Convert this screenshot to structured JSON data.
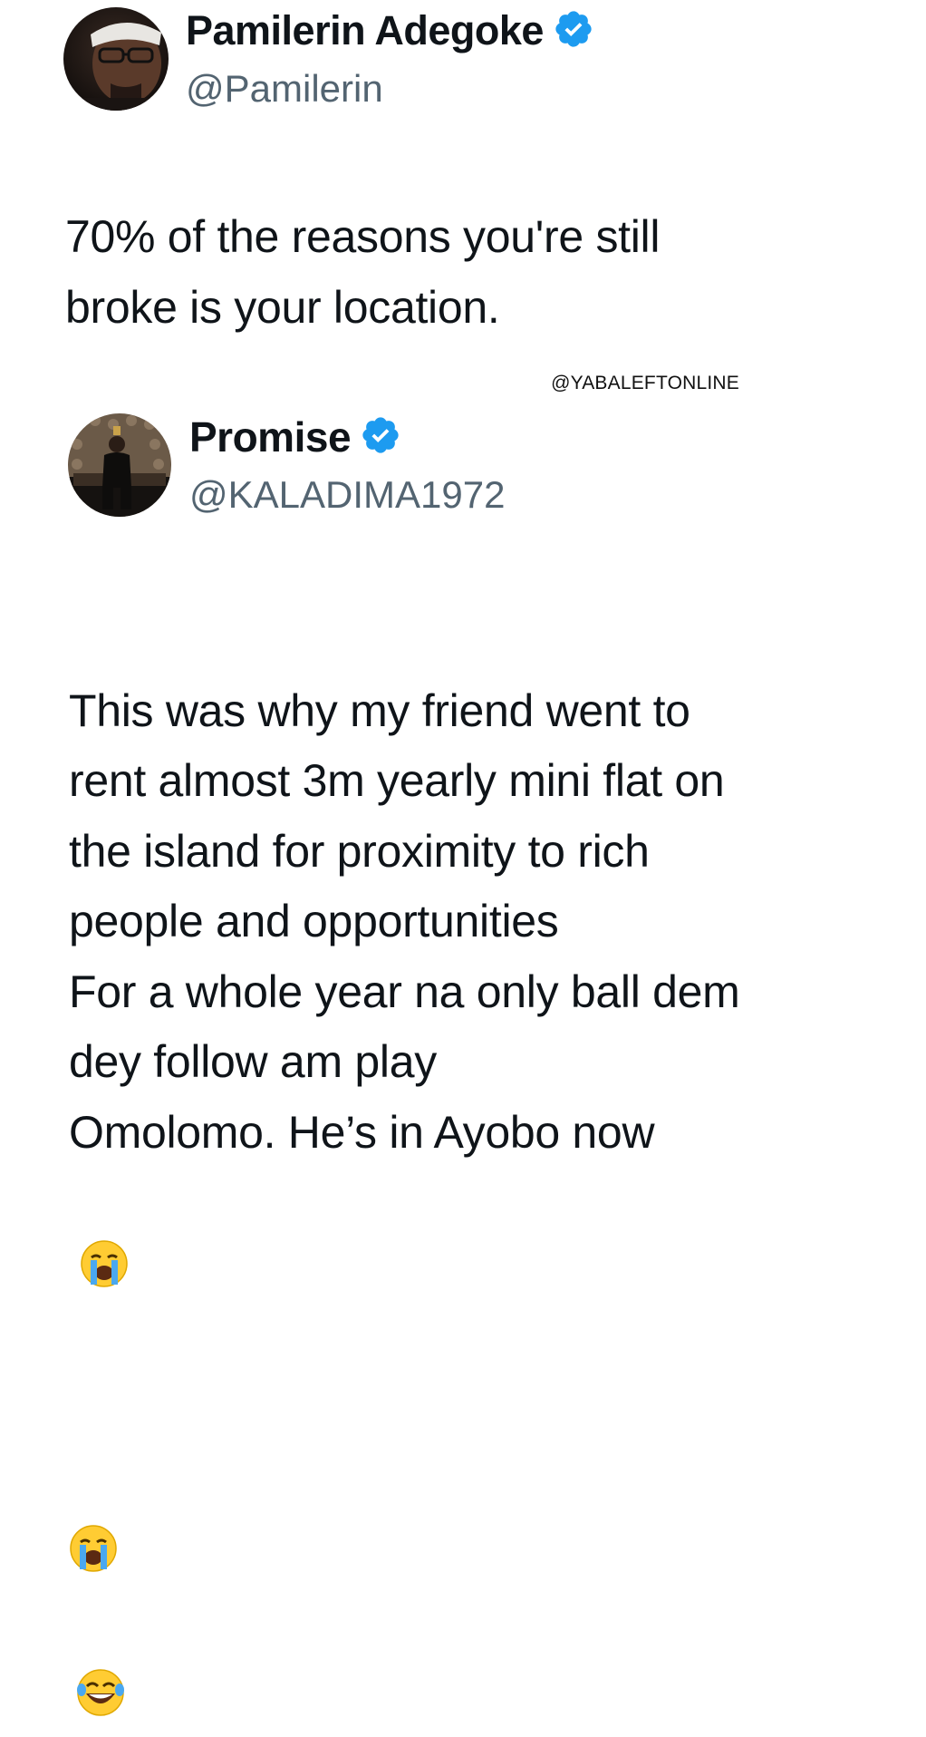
{
  "tweet1": {
    "display_name": "Pamilerin Adegoke",
    "handle": "@Pamilerin",
    "verified": true,
    "avatar_icon": "avatar-photo",
    "text": "70% of the reasons you're still\nbroke is your location."
  },
  "watermark": "@YABALEFTONLINE",
  "tweet2": {
    "display_name": "Promise",
    "handle": "@KALADIMA1972",
    "verified": true,
    "avatar_icon": "avatar-photo",
    "text": "This was why my friend went to\nrent almost 3m yearly mini flat on\nthe island for proximity to rich\npeople and opportunities\nFor a whole year na only ball dem\ndey follow am play\nOmolomo. He’s in Ayobo now",
    "trailing_emojis": [
      "loudly-crying-face",
      "loudly-crying-face",
      "tears-of-joy-face"
    ]
  },
  "colors": {
    "verified_blue": "#1d9bf0",
    "handle_gray": "#536471",
    "text": "#0f1419"
  }
}
